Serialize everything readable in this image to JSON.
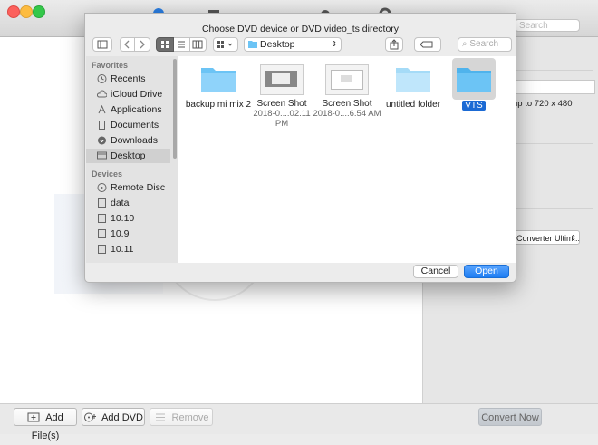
{
  "app": {
    "search_placeholder": "Search",
    "side_panel": {
      "resolution_text": "up to 720 x 480",
      "output_format_value": "Converter Ultim..."
    },
    "bottom_bar": {
      "add_files_label": "Add File(s)",
      "add_dvd_label": "Add DVD",
      "remove_label": "Remove",
      "convert_now_label": "Convert Now"
    }
  },
  "dialog": {
    "title": "Choose DVD device or DVD video_ts directory",
    "location": "Desktop",
    "search_placeholder": "Search",
    "sidebar": {
      "favorites_header": "Favorites",
      "favorites": [
        {
          "label": "Recents",
          "icon": "clock-icon"
        },
        {
          "label": "iCloud Drive",
          "icon": "cloud-icon"
        },
        {
          "label": "Applications",
          "icon": "applications-icon"
        },
        {
          "label": "Documents",
          "icon": "document-icon"
        },
        {
          "label": "Downloads",
          "icon": "download-icon"
        },
        {
          "label": "Desktop",
          "icon": "desktop-icon",
          "selected": true
        }
      ],
      "devices_header": "Devices",
      "devices": [
        {
          "label": "Remote Disc",
          "icon": "disc-icon"
        },
        {
          "label": "data",
          "icon": "drive-icon"
        },
        {
          "label": "10.10",
          "icon": "drive-icon"
        },
        {
          "label": "10.9",
          "icon": "drive-icon"
        },
        {
          "label": "10.11",
          "icon": "drive-icon"
        }
      ]
    },
    "files": [
      {
        "name": "backup mi mix 2",
        "sub": "",
        "kind": "folder"
      },
      {
        "name": "Screen Shot",
        "sub": "2018-0....02.11 PM",
        "kind": "screenshot"
      },
      {
        "name": "Screen Shot",
        "sub": "2018-0....6.54 AM",
        "kind": "screenshot"
      },
      {
        "name": "untitled folder",
        "sub": "",
        "kind": "folder"
      },
      {
        "name": "VTS",
        "sub": "",
        "kind": "folder",
        "selected": true
      }
    ],
    "cancel_label": "Cancel",
    "open_label": "Open"
  },
  "colors": {
    "accent": "#1d7cf2",
    "folder": "#6cc4f5"
  }
}
